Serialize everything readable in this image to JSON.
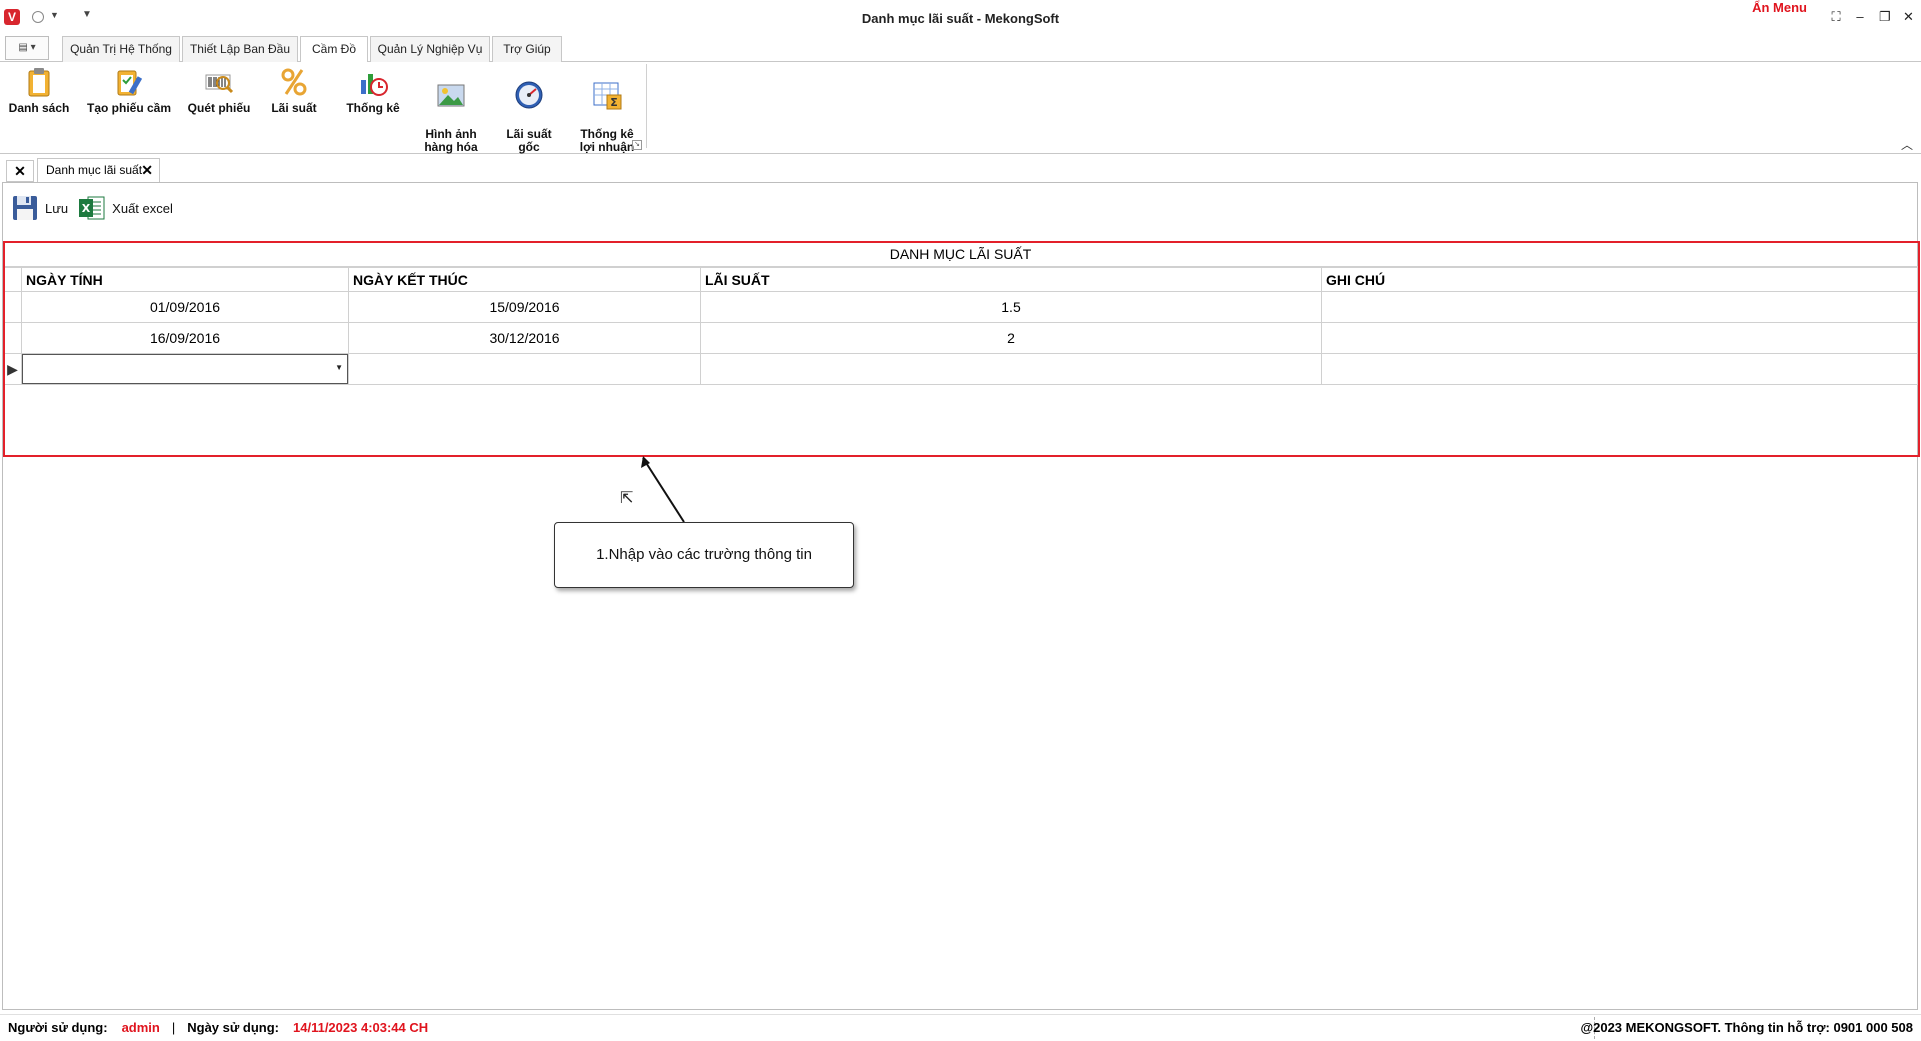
{
  "window": {
    "title": "Danh mục lãi suất - MekongSoft",
    "hide_menu": "Ẩn Menu"
  },
  "ribbon": {
    "tabs": [
      {
        "label": "Quản Trị Hệ Thống"
      },
      {
        "label": "Thiết Lập Ban Đầu"
      },
      {
        "label": "Cầm Đồ"
      },
      {
        "label": "Quản Lý Nghiệp Vụ"
      },
      {
        "label": "Trợ Giúp"
      }
    ],
    "active_tab": "Cầm Đồ",
    "buttons": [
      {
        "label": "Danh sách",
        "icon": "clipboard-icon"
      },
      {
        "label": "Tạo phiếu cầm",
        "icon": "checklist-pencil-icon"
      },
      {
        "label": "Quét phiếu",
        "icon": "barcode-scan-icon"
      },
      {
        "label": "Lãi suất",
        "icon": "percent-icon"
      },
      {
        "label": "Thống kê",
        "icon": "chart-clock-icon"
      },
      {
        "label": "Hình ảnh\nhàng hóa",
        "icon": "picture-icon"
      },
      {
        "label": "Lãi suất\ngốc",
        "icon": "gauge-icon"
      },
      {
        "label": "Thống kê\nlợi nhuận",
        "icon": "sum-table-icon"
      }
    ]
  },
  "doc_tab": {
    "label": "Danh mục lãi suất"
  },
  "toolbar": {
    "save_label": "Lưu",
    "export_label": "Xuất excel"
  },
  "grid": {
    "title": "DANH MỤC LÃI SUẤT",
    "columns": [
      "NGÀY TÍNH",
      "NGÀY KẾT THÚC",
      "LÃI SUẤT",
      "GHI CHÚ"
    ],
    "rows": [
      {
        "start": "01/09/2016",
        "end": "15/09/2016",
        "rate": "1.5",
        "note": ""
      },
      {
        "start": "16/09/2016",
        "end": "30/12/2016",
        "rate": "2",
        "note": ""
      }
    ]
  },
  "annotation": {
    "text": "1.Nhập vào các trường thông tin"
  },
  "status": {
    "user_label": "Người sử dụng:",
    "user_value": "admin",
    "sep": "|",
    "date_label": "Ngày sử dụng:",
    "date_value": "14/11/2023 4:03:44 CH",
    "copyright": "@2023 MEKONGSOFT. Thông tin hỗ trợ: 0901 000 508"
  },
  "colors": {
    "accent_red": "#e3202a",
    "status_red": "#e0141e"
  }
}
